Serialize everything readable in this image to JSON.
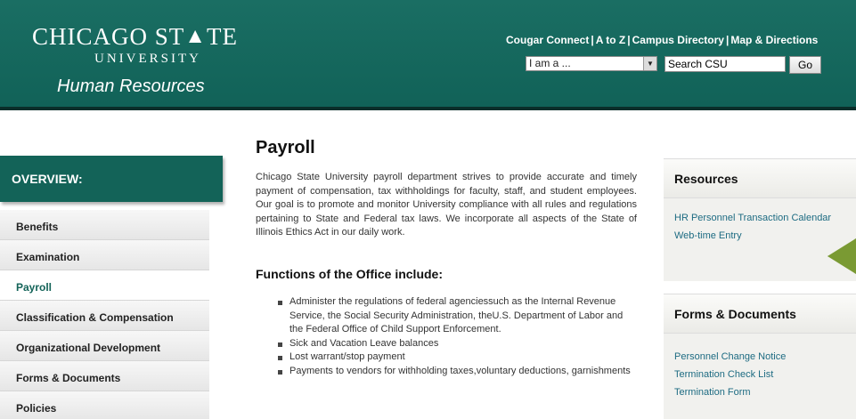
{
  "header": {
    "university_line1": "CHICAGO ST",
    "university_line1_end": "TE",
    "university_line2": "UNIVERSITY",
    "department": "Human Resources",
    "links": [
      "Cougar Connect",
      "A to Z",
      "Campus Directory",
      "Map & Directions"
    ],
    "separator": "|",
    "audience_select": "I am a ...",
    "search_value": "Search CSU",
    "go_label": "Go",
    "colors": {
      "header_bg": "#136358",
      "accent": "#7a9a33"
    }
  },
  "sidebar": {
    "heading": "OVERVIEW:",
    "items": [
      {
        "label": "Benefits"
      },
      {
        "label": "Examination"
      },
      {
        "label": "Payroll"
      },
      {
        "label": "Classification & Compensation"
      },
      {
        "label": "Organizational Development"
      },
      {
        "label": "Forms & Documents"
      },
      {
        "label": "Policies"
      }
    ],
    "active_index": 2
  },
  "main": {
    "title": "Payroll",
    "intro": "Chicago State University payroll department strives to provide accurate and timely payment of compensation, tax withholdings for faculty, staff, and student employees. Our goal is to promote and monitor University compliance with all rules and regulations pertaining to State and Federal tax laws. We incorporate all aspects of the State of Illinois Ethics Act in our daily work.",
    "functions_heading": "Functions of the Office include:",
    "functions": [
      "Administer the regulations of federal agenciessuch as the Internal Revenue Service, the Social Security Administration, theU.S. Department of Labor and the Federal Office of Child Support Enforcement.",
      "Sick and Vacation Leave balances",
      "Lost warrant/stop payment",
      "Payments to vendors for withholding taxes,voluntary deductions, garnishments"
    ]
  },
  "resources": {
    "heading": "Resources",
    "links": [
      "HR Personnel Transaction Calendar",
      "Web-time Entry"
    ]
  },
  "forms": {
    "heading": "Forms & Documents",
    "links": [
      "Personnel Change Notice",
      "Termination Check List",
      "Termination Form"
    ]
  }
}
